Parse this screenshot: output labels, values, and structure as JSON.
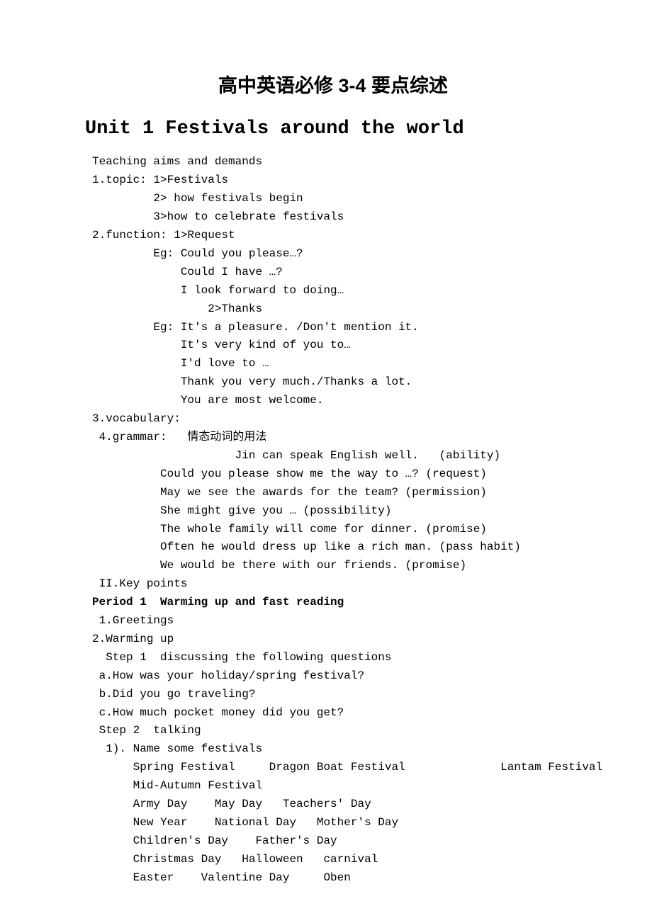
{
  "title_main": "高中英语必修 3-4  要点综述",
  "title_unit": "Unit 1 Festivals around the world",
  "lines": [
    "Teaching aims and demands",
    "1.topic: 1>Festivals",
    "         2> how festivals begin",
    "         3>how to celebrate festivals",
    "2.function: 1>Request",
    "         Eg: Could you please…?",
    "             Could I have …?",
    "             I look forward to doing…",
    "                 2>Thanks",
    "         Eg: It's a pleasure. /Don't mention it.",
    "             It's very kind of you to…",
    "             I'd love to …",
    "             Thank you very much./Thanks a lot.",
    "             You are most welcome.",
    "3.vocabulary:",
    " 4.grammar:   情态动词的用法",
    "                     Jin can speak English well.   (ability)",
    "          Could you please show me the way to …? (request)",
    "          May we see the awards for the team? (permission)",
    "          She might give you … (possibility)",
    "          The whole family will come for dinner. (promise)",
    "          Often he would dress up like a rich man. (pass habit)",
    "          We would be there with our friends. (promise)",
    " II.Key points"
  ],
  "period_heading": "Period 1  Warming up and fast reading",
  "lines2": [
    " 1.Greetings",
    "2.Warming up",
    "  Step 1  discussing the following questions",
    " a.How was your holiday/spring festival?",
    " b.Did you go traveling?",
    " c.How much pocket money did you get?",
    " Step 2  talking",
    "  1). Name some festivals",
    "      Spring Festival     Dragon Boat Festival              Lantam Festival",
    "      Mid-Autumn Festival",
    "      Army Day    May Day   Teachers' Day",
    "      New Year    National Day   Mother's Day",
    "      Children's Day    Father's Day",
    "      Christmas Day   Halloween   carnival",
    "      Easter    Valentine Day     Oben"
  ]
}
